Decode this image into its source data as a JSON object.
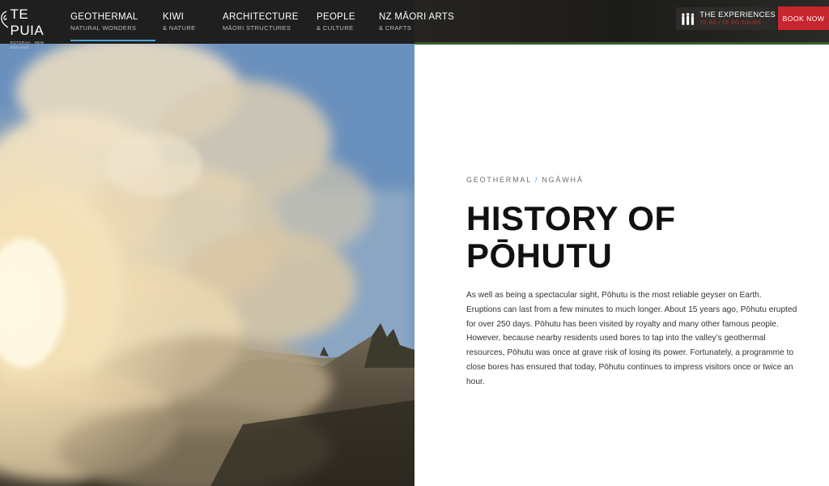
{
  "brand": {
    "name": "TE PUIA",
    "tagline": "ROTORUA · NEW ZEALAND"
  },
  "nav": [
    {
      "title": "GEOTHERMAL",
      "sub": "NATURAL WONDERS",
      "active": true
    },
    {
      "title": "KIWI",
      "sub": "& NATURE",
      "active": false
    },
    {
      "title": "ARCHITECTURE",
      "sub": "MĀORI STRUCTURES",
      "active": false
    },
    {
      "title": "PEOPLE",
      "sub": "& CULTURE",
      "active": false
    },
    {
      "title": "NZ MĀORI ARTS",
      "sub": "& CRAFTS",
      "active": false
    }
  ],
  "experiences": {
    "title": "THE EXPERIENCES",
    "sub": "TE RĀ / TE PŌ TOURS",
    "icon": "people-silhouettes-icon"
  },
  "book_now": "BOOK NOW",
  "colors": {
    "accent": "#4aa3d8",
    "brand_red": "#c8262f",
    "nav_bg": "#1f1f1f"
  },
  "article": {
    "breadcrumb_primary": "GEOTHERMAL",
    "breadcrumb_separator": "/",
    "breadcrumb_secondary": "NGĀWHĀ",
    "headline_line1": "HISTORY OF",
    "headline_line2": "PŌHUTU",
    "body": "As well as being a spectacular sight, Pōhutu is the most reliable geyser on Earth. Eruptions can last from a few minutes to much longer. About 15 years ago, Pōhutu erupted for over 250 days. Pōhutu has been visited by royalty and many other famous people. However, because nearby residents used bores to tap into the valley’s geothermal resources, Pōhutu was once at grave risk of losing its power. Fortunately, a programme to close bores has ensured that today, Pōhutu continues to impress visitors once or twice an hour."
  }
}
